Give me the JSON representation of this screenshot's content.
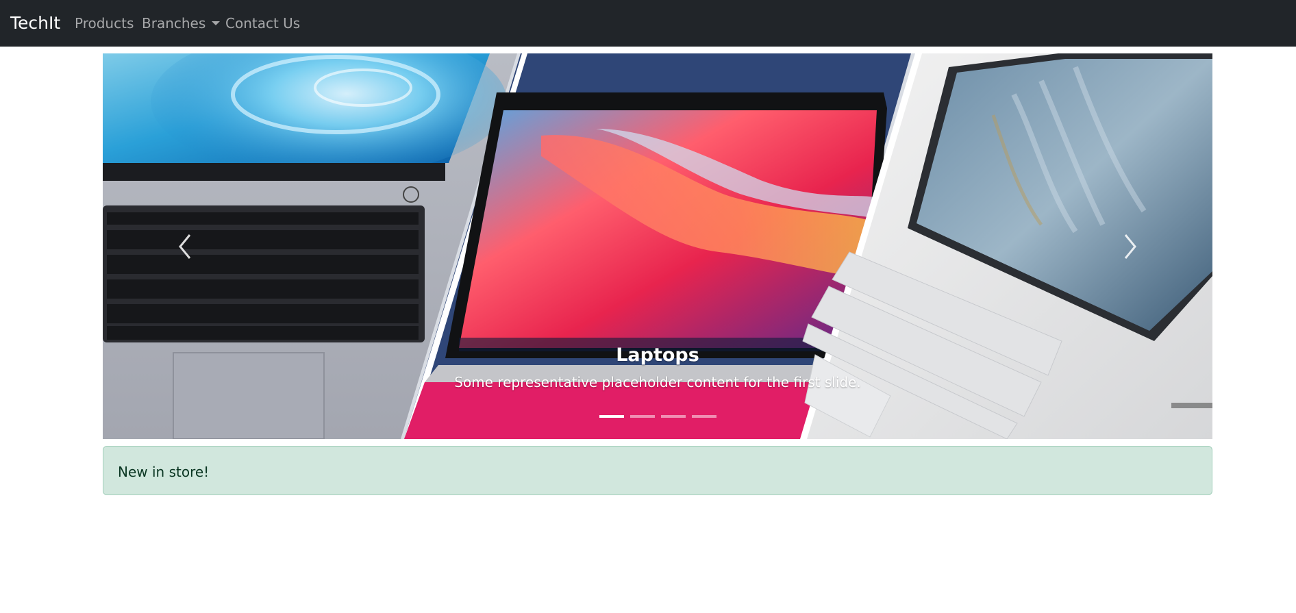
{
  "navbar": {
    "brand": "TechIt",
    "links": [
      {
        "label": "Products"
      },
      {
        "label": "Branches"
      },
      {
        "label": "Contact Us"
      }
    ]
  },
  "carousel": {
    "slides": [
      {
        "title": "Laptops",
        "text": "Some representative placeholder content for the first slide."
      }
    ],
    "active_indicator": 1,
    "indicator_count": 4,
    "controls": {
      "prev_icon": "chevron-left-icon",
      "next_icon": "chevron-right-icon"
    }
  },
  "alert": {
    "text": "New in store!",
    "variant_color": "#d1e7dd"
  },
  "colors": {
    "navbar_bg": "#212529",
    "alert_bg": "#d1e7dd",
    "alert_text": "#0a3622"
  }
}
